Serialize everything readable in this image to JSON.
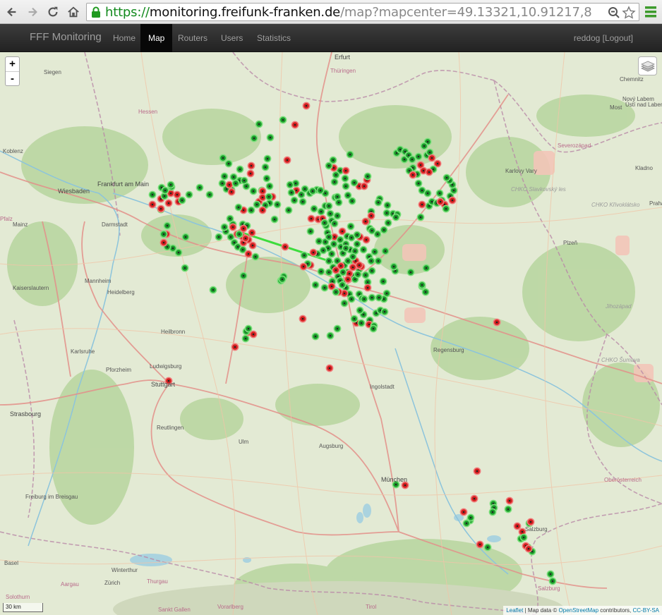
{
  "browser": {
    "url_scheme": "https://",
    "url_host": "monitoring.freifunk-franken.de",
    "url_path": "/map?mapcenter=49.13321,10.91217,8"
  },
  "navbar": {
    "brand": "FFF Monitoring",
    "links": [
      "Home",
      "Map",
      "Routers",
      "Users",
      "Statistics"
    ],
    "active": "Map",
    "user": "reddog [Logout]"
  },
  "map": {
    "zoom_in": "+",
    "zoom_out": "-",
    "scale": "30 km",
    "attribution": {
      "leaflet": "Leaflet",
      "sep": " | Map data © ",
      "osm": "OpenStreetMap",
      "contrib": " contributors, ",
      "license": "CC-BY-SA"
    },
    "places": [
      {
        "name": "Erfurt",
        "style": "big"
      },
      {
        "name": "Thüringen",
        "style": "region pink"
      },
      {
        "name": "Chemnitz",
        "style": "normal"
      },
      {
        "name": "Siegen",
        "style": "normal"
      },
      {
        "name": "Hessen",
        "style": "region pink"
      },
      {
        "name": "Koblenz",
        "style": "normal"
      },
      {
        "name": "Wiesbaden",
        "style": "big"
      },
      {
        "name": "Frankfurt am Main",
        "style": "big"
      },
      {
        "name": "Darmstadt",
        "style": "normal"
      },
      {
        "name": "Mainz",
        "style": "normal"
      },
      {
        "name": "Kaiserslautern",
        "style": "normal"
      },
      {
        "name": "Mannheim",
        "style": "normal"
      },
      {
        "name": "Heidelberg",
        "style": "normal"
      },
      {
        "name": "Heilbronn",
        "style": "normal"
      },
      {
        "name": "Pforzheim",
        "style": "normal"
      },
      {
        "name": "Karlsruhe",
        "style": "normal"
      },
      {
        "name": "Ludwigsburg",
        "style": "normal"
      },
      {
        "name": "Stuttgart",
        "style": "big"
      },
      {
        "name": "Reutlingen",
        "style": "normal"
      },
      {
        "name": "Strasbourg",
        "style": "big"
      },
      {
        "name": "Ulm",
        "style": "normal"
      },
      {
        "name": "Augsburg",
        "style": "normal"
      },
      {
        "name": "München",
        "style": "big"
      },
      {
        "name": "Ingolstadt",
        "style": "normal"
      },
      {
        "name": "Regensburg",
        "style": "normal"
      },
      {
        "name": "Freiburg im Breisgau",
        "style": "normal"
      },
      {
        "name": "Basel",
        "style": "normal"
      },
      {
        "name": "Winterthur",
        "style": "normal"
      },
      {
        "name": "Zürich",
        "style": "normal"
      },
      {
        "name": "Thurgau",
        "style": "region pink"
      },
      {
        "name": "Aargau",
        "style": "region pink"
      },
      {
        "name": "Solothurn",
        "style": "region pink"
      },
      {
        "name": "Sankt Gallen",
        "style": "region pink"
      },
      {
        "name": "Vorarlberg",
        "style": "region pink"
      },
      {
        "name": "Tirol",
        "style": "region pink"
      },
      {
        "name": "Salzburg",
        "style": "normal"
      },
      {
        "name": "Salzburg",
        "style": "region pink"
      },
      {
        "name": "Oberösterreich",
        "style": "region pink"
      },
      {
        "name": "Jihozápad",
        "style": "region"
      },
      {
        "name": "Severozápad",
        "style": "region pink"
      },
      {
        "name": "Karlovy Vary",
        "style": "normal"
      },
      {
        "name": "CHKO Slavkovský les",
        "style": "region"
      },
      {
        "name": "CHKO Křivoklátsko",
        "style": "region"
      },
      {
        "name": "Plzeň",
        "style": "normal"
      },
      {
        "name": "CHKO Šumava",
        "style": "region"
      },
      {
        "name": "Most",
        "style": "normal"
      },
      {
        "name": "Nový Labem",
        "style": "normal"
      },
      {
        "name": "Ústí nad Labem",
        "style": "normal"
      },
      {
        "name": "Kladno",
        "style": "normal"
      },
      {
        "name": "Praha",
        "style": "normal"
      },
      {
        "name": "Pfalz",
        "style": "region pink"
      }
    ]
  },
  "colors": {
    "node_online": "#1a9c2a",
    "node_offline": "#d41e1e",
    "link": "#3ddc3d"
  },
  "icons": [
    "back-icon",
    "forward-icon",
    "reload-icon",
    "home-icon",
    "lock-icon",
    "zoom-icon",
    "star-icon",
    "menu-icon",
    "layers-icon"
  ]
}
